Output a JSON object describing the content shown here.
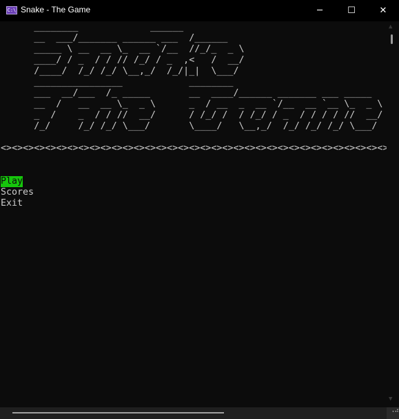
{
  "window": {
    "title": "Snake - The Game",
    "icon": "console-icon",
    "minimize": "─",
    "maximize": "☐",
    "close": "✕"
  },
  "banner": {
    "snake": "      ________             ______       \n      __  ___/_______ ______ ___  /______ \n      _____ \\ __  __ \\_  __ `/__  //_/_  _ \\\n      ____/ / _  / / // /_/ / _  ,<   /  __/\n      /____/  /_/ /_/ \\__,_/  /_/|_|  \\___/ ",
    "the_game": "      ________________            ________                        \n      ___  __/___  /_ _____       __  ____/______ _______ ___ _____ \n      __  /   __  __ \\_  _ \\      _  / __  _  __ `/__  __ `__ \\_  _ \\\n      _  /    _  / / //  __/      / /_/ /  / /_/ / _  / / / / //  __/\n      /_/     /_/ /_/ \\___/       \\____/   \\__,_/  /_/ /_/ /_/ \\___/ ",
    "separator": "<><><><><><><><><><><><><><><><><><><><><><><><><><><><><><><><><><><><>"
  },
  "menu": {
    "items": [
      {
        "label": "Play",
        "selected": true
      },
      {
        "label": "Scores"
      },
      {
        "label": "Exit"
      }
    ]
  },
  "colors": {
    "selected_bg": "#16c60c",
    "background": "#0c0c0c",
    "text": "#cccccc"
  }
}
